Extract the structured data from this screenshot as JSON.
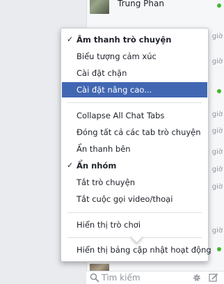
{
  "contact": {
    "name": "Trung Phan"
  },
  "side_hints": [
    "giờ",
    "giờ",
    "giờ",
    "giờ",
    "giờ",
    "giờ",
    "giờ",
    "giờ"
  ],
  "menu": {
    "items": [
      {
        "label": "Âm thanh trò chuyện",
        "checked": true,
        "bold": true,
        "selected": false
      },
      {
        "label": "Biểu tượng cảm xúc",
        "checked": false,
        "bold": false,
        "selected": false
      },
      {
        "label": "Cài đặt chặn",
        "checked": false,
        "bold": false,
        "selected": false
      },
      {
        "label": "Cài đặt nâng cao...",
        "checked": false,
        "bold": false,
        "selected": true
      },
      {
        "label": "Collapse All Chat Tabs",
        "checked": false,
        "bold": false,
        "selected": false
      },
      {
        "label": "Đóng tất cả các tab trò chuyện",
        "checked": false,
        "bold": false,
        "selected": false
      },
      {
        "label": "Ẩn thanh bên",
        "checked": false,
        "bold": false,
        "selected": false
      },
      {
        "label": "Ẩn nhóm",
        "checked": true,
        "bold": true,
        "selected": false
      },
      {
        "label": "Tắt trò chuyện",
        "checked": false,
        "bold": false,
        "selected": false
      },
      {
        "label": "Tắt cuộc gọi video/thoại",
        "checked": false,
        "bold": false,
        "selected": false
      },
      {
        "label": "Hiển thị trò chơi",
        "checked": false,
        "bold": false,
        "selected": false
      },
      {
        "label": "Hiển thị bảng cập nhật hoạt động",
        "checked": false,
        "bold": false,
        "selected": false
      }
    ],
    "check_glyph": "✓"
  },
  "search": {
    "placeholder": "Tìm kiếm"
  },
  "colors": {
    "selected_bg": "#4267b2",
    "online": "#42b72a"
  },
  "icons": {
    "search": "search-icon",
    "settings": "gear-icon",
    "compose": "compose-icon"
  }
}
